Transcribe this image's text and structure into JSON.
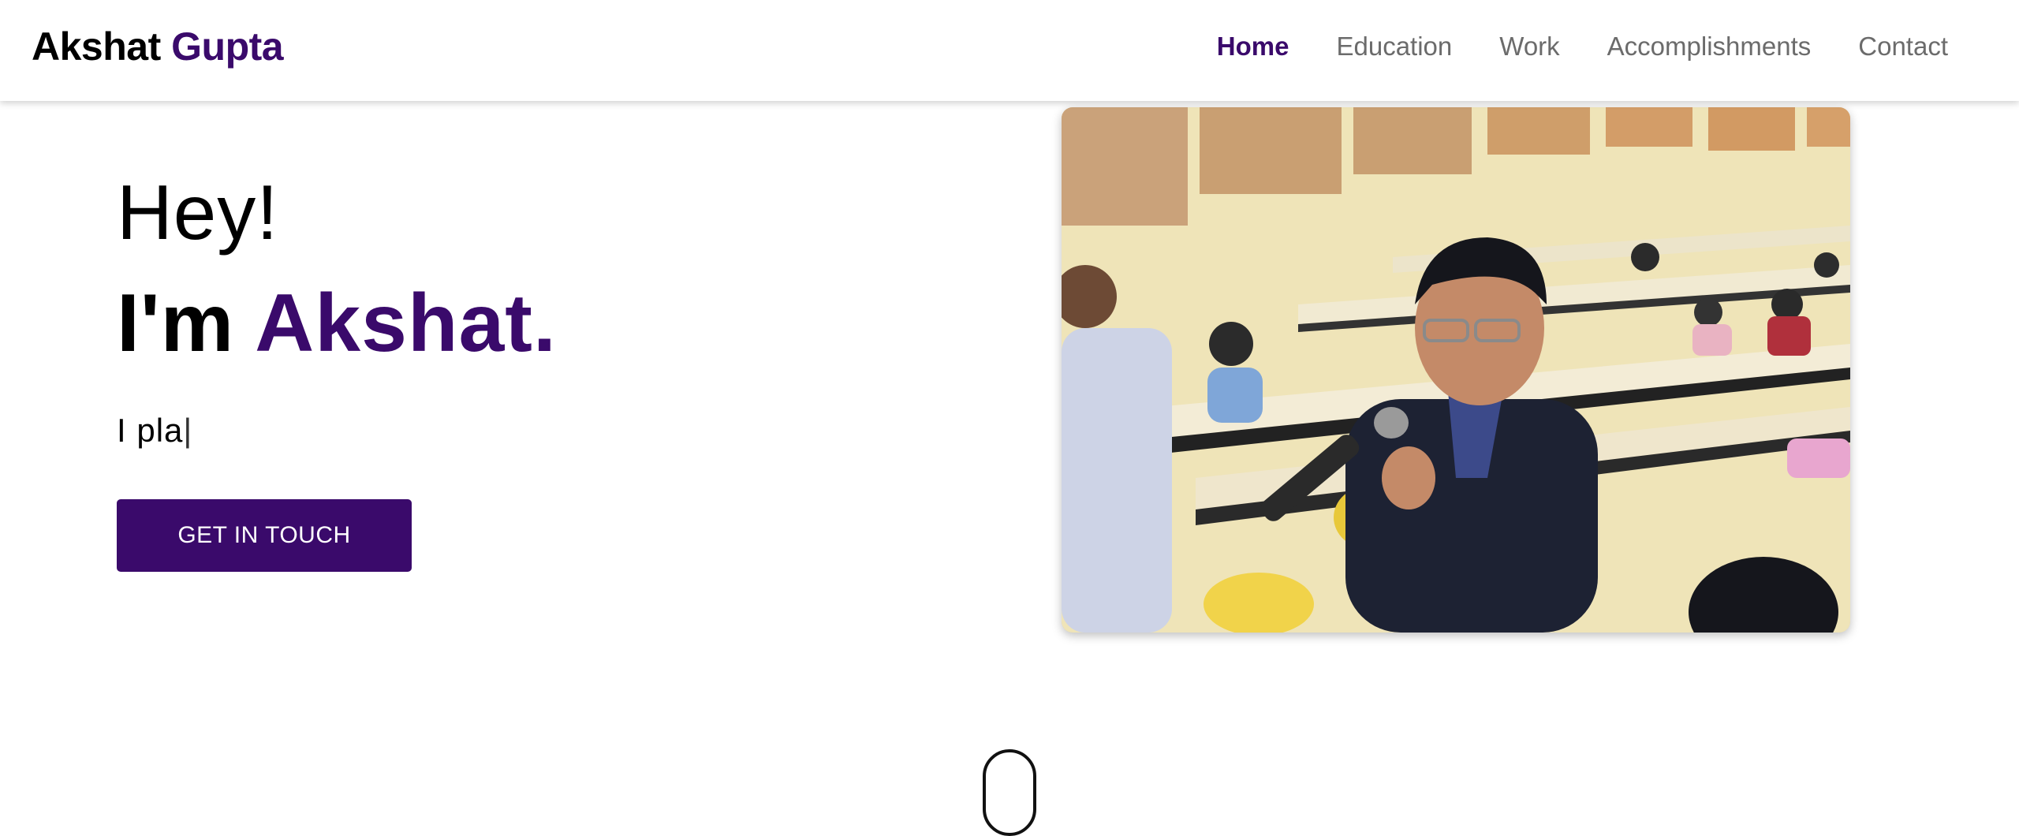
{
  "brand": {
    "first": "Akshat",
    "last": "Gupta"
  },
  "nav": {
    "items": [
      {
        "label": "Home",
        "active": true
      },
      {
        "label": "Education",
        "active": false
      },
      {
        "label": "Work",
        "active": false
      },
      {
        "label": "Accomplishments",
        "active": false
      },
      {
        "label": "Contact",
        "active": false
      }
    ]
  },
  "hero": {
    "greeting": "Hey!",
    "intro_prefix": "I'm",
    "intro_name": "Akshat.",
    "typed_text": "I pla",
    "caret": "|",
    "cta_label": "GET IN TOUCH"
  },
  "colors": {
    "accent": "#3a0a6b",
    "nav_text": "#6b6b6b",
    "background": "#ffffff"
  },
  "icons": {
    "scroll_indicator": "mouse-scroll-icon"
  }
}
